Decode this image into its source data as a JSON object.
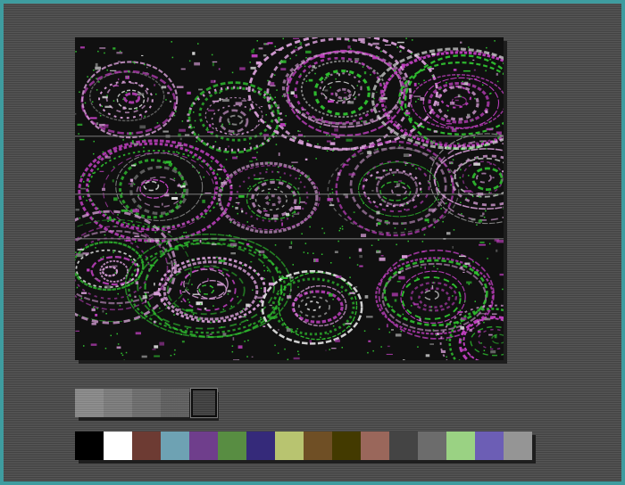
{
  "app": {
    "background_color": "#3e9c9f"
  },
  "canvas": {
    "icon": "psychedelic-pattern-image",
    "colors": {
      "base": "#101010",
      "magenta": "#c040c0",
      "pink": "#d9a0d9",
      "green": "#30c030",
      "white": "#e0e0e0",
      "gray": "#8a8a8a"
    }
  },
  "gray_strip": {
    "cells": [
      {
        "color": "#8a8a8a"
      },
      {
        "color": "#7c7c7c"
      },
      {
        "color": "#6c6c6c"
      },
      {
        "color": "#5e5e5e"
      },
      {
        "color": "#3d3d3d",
        "selected": true
      }
    ]
  },
  "palette": {
    "swatches": [
      {
        "color": "#000000"
      },
      {
        "color": "#ffffff"
      },
      {
        "color": "#6d3b33"
      },
      {
        "color": "#6ea2b3"
      },
      {
        "color": "#6f3e8c"
      },
      {
        "color": "#588d42"
      },
      {
        "color": "#352a7a"
      },
      {
        "color": "#b8c470"
      },
      {
        "color": "#6f4f25"
      },
      {
        "color": "#433a00"
      },
      {
        "color": "#9a675b"
      },
      {
        "color": "#444444"
      },
      {
        "color": "#6c6c6c"
      },
      {
        "color": "#9ad283"
      },
      {
        "color": "#6c5eb5"
      },
      {
        "color": "#959595"
      }
    ]
  }
}
